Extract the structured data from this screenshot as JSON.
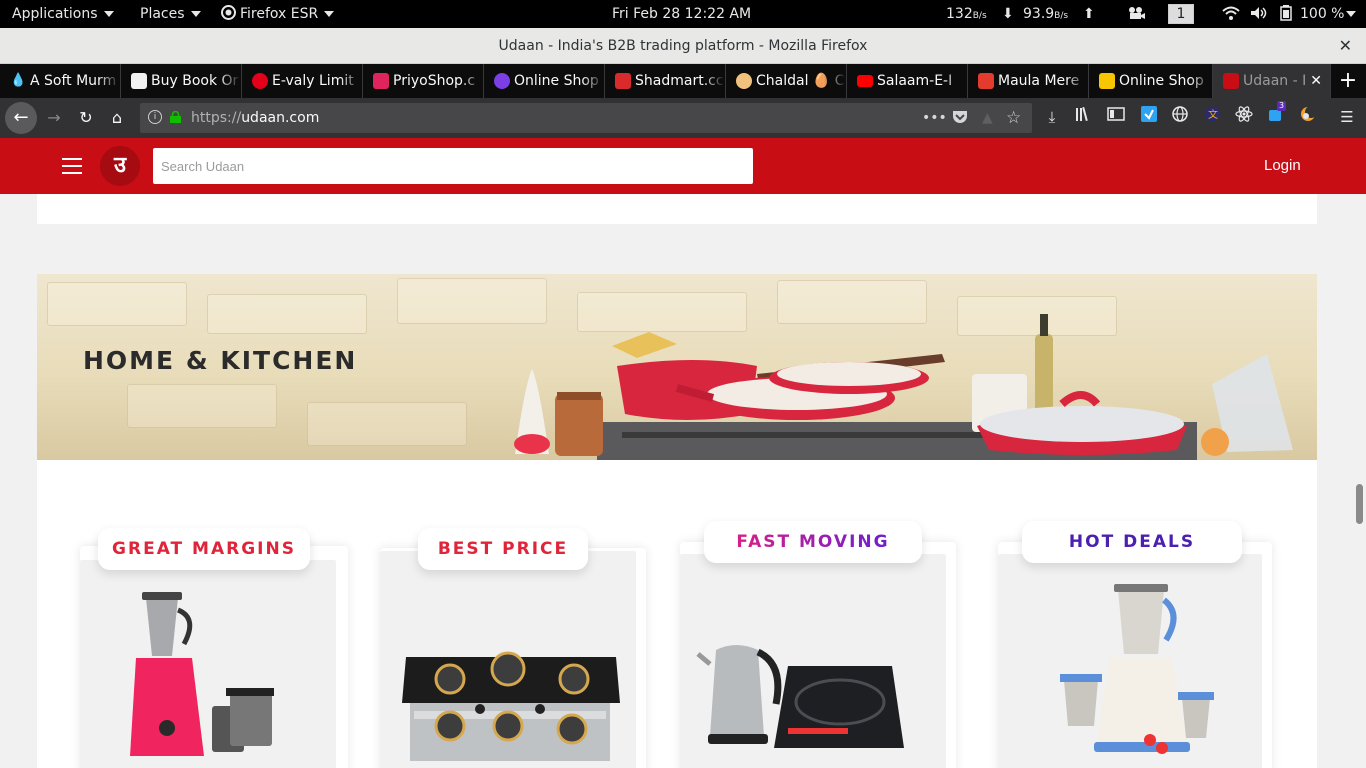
{
  "os_bar": {
    "applications": "Applications",
    "places": "Places",
    "firefox": "Firefox ESR",
    "clock": "Fri Feb 28  12:22 AM",
    "net_down": "132",
    "net_down_unit": "B/s",
    "net_up": "93.9",
    "net_up_unit": "B/s",
    "workspace": "1",
    "battery": "100 %"
  },
  "window": {
    "title": "Udaan - India's B2B trading platform - Mozilla Firefox"
  },
  "tabs": [
    {
      "label": "A Soft Murm",
      "color": "#4aa3ff"
    },
    {
      "label": "Buy Book Or",
      "color": "#f2f2f2"
    },
    {
      "label": "E-valy Limit",
      "color": "#e2001a"
    },
    {
      "label": "PriyoShop.c",
      "color": "#e0245e"
    },
    {
      "label": "Online Shop",
      "color": "#7b3fe4"
    },
    {
      "label": "Shadmart.cc",
      "color": "#d92b2b"
    },
    {
      "label": "Chaldal 🥚 C",
      "color": "#f1c27d"
    },
    {
      "label": "Salaam-E-I",
      "color": "#ff0000"
    },
    {
      "label": "Maula Mere",
      "color": "#e33b2e"
    },
    {
      "label": "Online Shop",
      "color": "#f7c600"
    },
    {
      "label": "Udaan - I",
      "color": "#c90d14"
    }
  ],
  "nav": {
    "url_prefix": "https://",
    "url_domain": "udaan.com",
    "addon_badge": "3"
  },
  "site": {
    "search_placeholder": "Search Udaan",
    "login": "Login",
    "logo_glyph": "उ",
    "banner_title": "HOME & KITCHEN",
    "cards": [
      {
        "label": "GREAT MARGINS",
        "color": "#e0243a",
        "product": "mixer-grinder-icon"
      },
      {
        "label": "BEST PRICE",
        "color": "#e0243a",
        "product": "gas-stove-icon"
      },
      {
        "label": "FAST MOVING",
        "color": "#b01fd6",
        "product": "kettle-induction-icon"
      },
      {
        "label": "HOT DEALS",
        "color": "#4b1fb0",
        "product": "mixer-set-icon"
      }
    ]
  }
}
